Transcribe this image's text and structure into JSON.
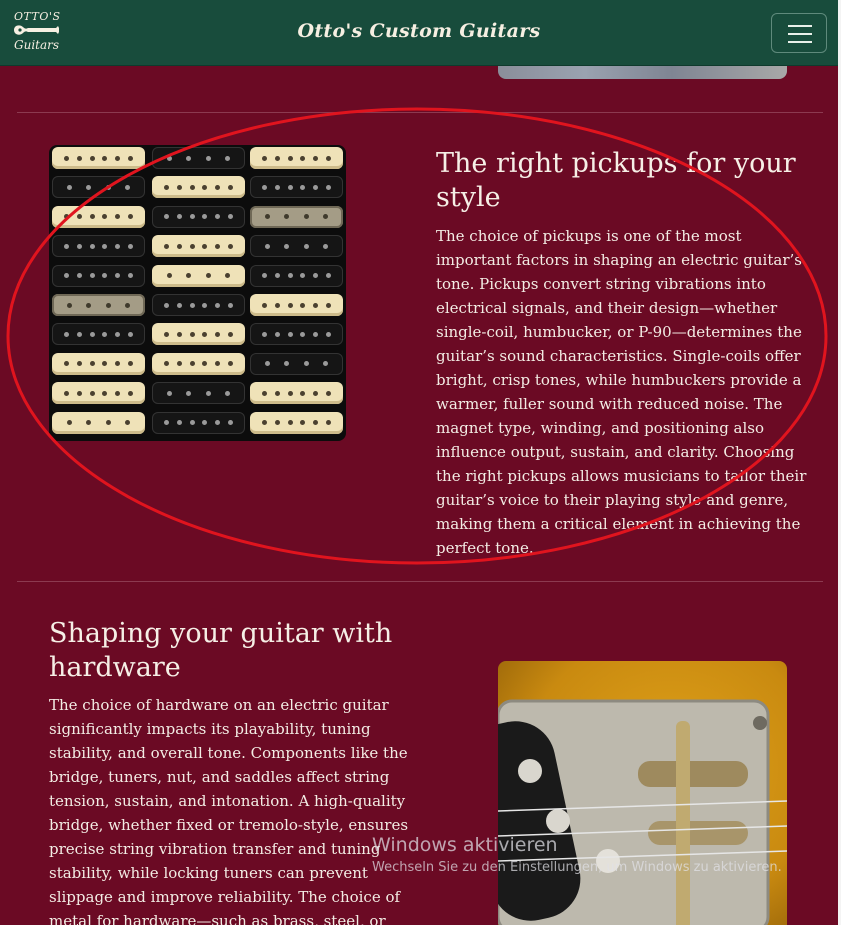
{
  "navbar": {
    "logo_line1": "OTTO'S",
    "logo_line2": "Guitars",
    "brand": "Otto's Custom Guitars",
    "toggler_icon": "hamburger-menu-icon"
  },
  "sections": [
    {
      "title": "The right pickups for your style",
      "text": "The choice of pickups is one of the most important factors in shaping an electric guitar’s tone. Pickups convert string vibrations into electrical signals, and their design—whether single-coil, humbucker, or P-90—determines the guitar’s sound characteristics. Single-coils offer bright, crisp tones, while humbuckers provide a warmer, fuller sound with reduced noise. The magnet type, winding, and positioning also influence output, sustain, and clarity. Choosing the right pickups allows musicians to tailor their guitar’s voice to their playing style and genre, making them a critical element in achieving the perfect tone."
    },
    {
      "title": "Shaping your guitar with hardware",
      "text": "The choice of hardware on an electric guitar significantly impacts its playability, tuning stability, and overall tone. Components like the bridge, tuners, nut, and saddles affect string tension, sustain, and intonation. A high-quality bridge, whether fixed or tremolo-style, ensures precise string vibration transfer and tuning stability, while locking tuners can prevent slippage and improve reliability. The choice of metal for hardware—such as brass, steel, or zinc—also"
    }
  ],
  "watermark": {
    "line1": "Windows aktivieren",
    "line2": "Wechseln Sie zu den Einstellungen, um Windows zu aktivieren."
  },
  "colors": {
    "navbar_bg": "#184c3c",
    "page_bg": "#6b0a24",
    "annotation": "#e0141e"
  }
}
